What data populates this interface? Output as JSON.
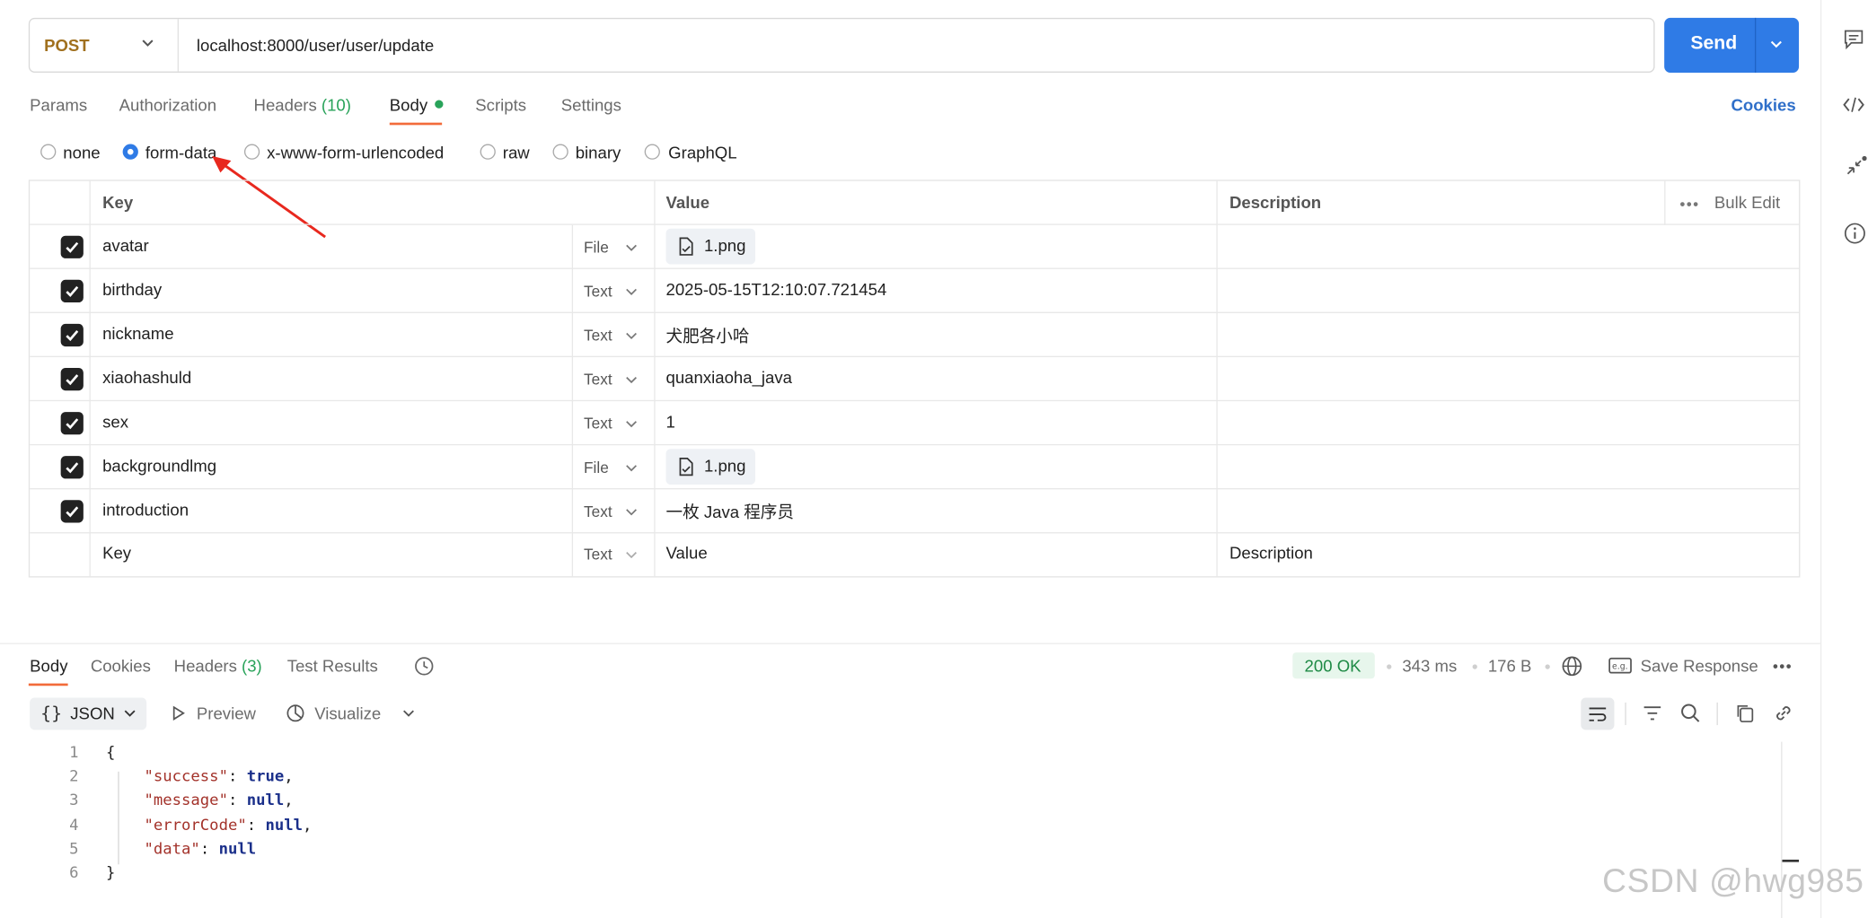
{
  "request": {
    "method": "POST",
    "url": "localhost:8000/user/user/update",
    "send_label": "Send"
  },
  "tabs": [
    {
      "label": "Params"
    },
    {
      "label": "Authorization"
    },
    {
      "label": "Headers"
    },
    {
      "label": "Body"
    },
    {
      "label": "Scripts"
    },
    {
      "label": "Settings"
    }
  ],
  "headers_count": "(10)",
  "cookies_label": "Cookies",
  "body_types": [
    "none",
    "form-data",
    "x-www-form-urlencoded",
    "raw",
    "binary",
    "GraphQL"
  ],
  "selected_body_type": "form-data",
  "table": {
    "columns": [
      "Key",
      "Value",
      "Description"
    ],
    "bulk_edit": "Bulk Edit",
    "rows": [
      {
        "key": "avatar",
        "type": "File",
        "value": "1.png",
        "checked": true
      },
      {
        "key": "birthday",
        "type": "Text",
        "value": "2025-05-15T12:10:07.721454",
        "checked": true
      },
      {
        "key": "nickname",
        "type": "Text",
        "value": "犬肥各小哈",
        "checked": true
      },
      {
        "key": "xiaohashuld",
        "type": "Text",
        "value": "quanxiaoha_java",
        "checked": true
      },
      {
        "key": "sex",
        "type": "Text",
        "value": "1",
        "checked": true
      },
      {
        "key": "backgroundlmg",
        "type": "File",
        "value": "1.png",
        "checked": true
      },
      {
        "key": "introduction",
        "type": "Text",
        "value": "一枚 Java 程序员",
        "checked": true
      }
    ],
    "placeholder": {
      "key": "Key",
      "type": "Text",
      "value": "Value",
      "description": "Description"
    }
  },
  "response": {
    "tabs": [
      {
        "label": "Body"
      },
      {
        "label": "Cookies"
      },
      {
        "label": "Headers"
      },
      {
        "label": "Test Results"
      }
    ],
    "headers_count": "(3)",
    "status": "200 OK",
    "time": "343 ms",
    "size": "176 B",
    "save_label": "Save Response",
    "format": "JSON",
    "preview_label": "Preview",
    "visualize_label": "Visualize",
    "code_lines": [
      {
        "n": "1",
        "text": "{"
      },
      {
        "n": "2",
        "key": "\"success\"",
        "value": "true",
        "end": ","
      },
      {
        "n": "3",
        "key": "\"message\"",
        "value": "null",
        "end": ","
      },
      {
        "n": "4",
        "key": "\"errorCode\"",
        "value": "null",
        "end": ","
      },
      {
        "n": "5",
        "key": "\"data\"",
        "value": "null",
        "end": ""
      },
      {
        "n": "6",
        "text": "}"
      }
    ]
  },
  "watermark": "CSDN @hwg985",
  "colors": {
    "send": "#2f7be6",
    "accent_tab": "#f26b3a",
    "status_ok": "#1e8a45",
    "method": "#a0701e"
  }
}
